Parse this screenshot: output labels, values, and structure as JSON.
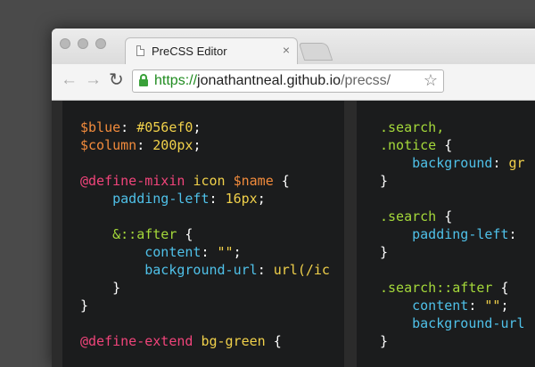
{
  "browser": {
    "tab_title": "PreCSS Editor",
    "tab_close": "×",
    "url_scheme": "https://",
    "url_host": "jonathantneal.github.io",
    "url_path": "/precss/",
    "back_icon": "←",
    "forward_icon": "→",
    "reload_icon": "↻",
    "bookmark_icon": "☆"
  },
  "colors": {
    "variable": "#f28b3c",
    "at_rule": "#f0447a",
    "property": "#4fc1e9",
    "value": "#f0d04a",
    "selector": "#a4d83a",
    "punct": "#ffffff",
    "plain": "#dedede"
  },
  "editor": {
    "left_lines": [
      [
        {
          "t": "$blue",
          "c": "variable"
        },
        {
          "t": ": ",
          "c": "punct"
        },
        {
          "t": "#056ef0",
          "c": "value"
        },
        {
          "t": ";",
          "c": "punct"
        }
      ],
      [
        {
          "t": "$column",
          "c": "variable"
        },
        {
          "t": ": ",
          "c": "punct"
        },
        {
          "t": "200px",
          "c": "value"
        },
        {
          "t": ";",
          "c": "punct"
        }
      ],
      [],
      [
        {
          "t": "@define-mixin",
          "c": "at_rule"
        },
        {
          "t": " ",
          "c": "plain"
        },
        {
          "t": "icon",
          "c": "value"
        },
        {
          "t": " ",
          "c": "plain"
        },
        {
          "t": "$name",
          "c": "variable"
        },
        {
          "t": " {",
          "c": "punct"
        }
      ],
      [
        {
          "t": "    ",
          "c": "plain"
        },
        {
          "t": "padding-left",
          "c": "property"
        },
        {
          "t": ": ",
          "c": "punct"
        },
        {
          "t": "16px",
          "c": "value"
        },
        {
          "t": ";",
          "c": "punct"
        }
      ],
      [],
      [
        {
          "t": "    ",
          "c": "plain"
        },
        {
          "t": "&::after",
          "c": "selector"
        },
        {
          "t": " {",
          "c": "punct"
        }
      ],
      [
        {
          "t": "        ",
          "c": "plain"
        },
        {
          "t": "content",
          "c": "property"
        },
        {
          "t": ": ",
          "c": "punct"
        },
        {
          "t": "\"\"",
          "c": "value"
        },
        {
          "t": ";",
          "c": "punct"
        }
      ],
      [
        {
          "t": "        ",
          "c": "plain"
        },
        {
          "t": "background-url",
          "c": "property"
        },
        {
          "t": ": ",
          "c": "punct"
        },
        {
          "t": "url(/ic",
          "c": "value"
        }
      ],
      [
        {
          "t": "    }",
          "c": "punct"
        }
      ],
      [
        {
          "t": "}",
          "c": "punct"
        }
      ],
      [],
      [
        {
          "t": "@define-extend",
          "c": "at_rule"
        },
        {
          "t": " ",
          "c": "plain"
        },
        {
          "t": "bg-green",
          "c": "value"
        },
        {
          "t": " {",
          "c": "punct"
        }
      ]
    ],
    "right_lines": [
      [
        {
          "t": ".search,",
          "c": "selector"
        }
      ],
      [
        {
          "t": ".notice",
          "c": "selector"
        },
        {
          "t": " {",
          "c": "punct"
        }
      ],
      [
        {
          "t": "    ",
          "c": "plain"
        },
        {
          "t": "background",
          "c": "property"
        },
        {
          "t": ": ",
          "c": "punct"
        },
        {
          "t": "gr",
          "c": "value"
        }
      ],
      [
        {
          "t": "}",
          "c": "punct"
        }
      ],
      [],
      [
        {
          "t": ".search",
          "c": "selector"
        },
        {
          "t": " {",
          "c": "punct"
        }
      ],
      [
        {
          "t": "    ",
          "c": "plain"
        },
        {
          "t": "padding-left",
          "c": "property"
        },
        {
          "t": ":",
          "c": "punct"
        }
      ],
      [
        {
          "t": "}",
          "c": "punct"
        }
      ],
      [],
      [
        {
          "t": ".search::after",
          "c": "selector"
        },
        {
          "t": " {",
          "c": "punct"
        }
      ],
      [
        {
          "t": "    ",
          "c": "plain"
        },
        {
          "t": "content",
          "c": "property"
        },
        {
          "t": ": ",
          "c": "punct"
        },
        {
          "t": "\"\"",
          "c": "value"
        },
        {
          "t": ";",
          "c": "punct"
        }
      ],
      [
        {
          "t": "    ",
          "c": "plain"
        },
        {
          "t": "background-url",
          "c": "property"
        }
      ],
      [
        {
          "t": "}",
          "c": "punct"
        }
      ]
    ]
  }
}
